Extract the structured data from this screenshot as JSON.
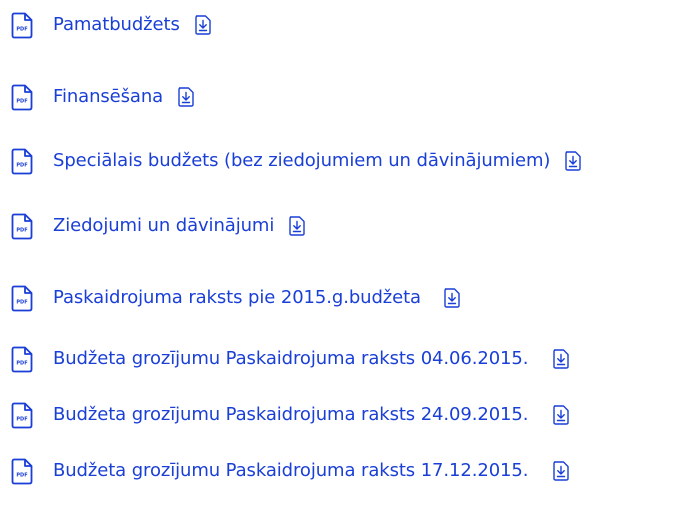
{
  "colors": {
    "link": "#1a3fd6"
  },
  "icons": {
    "file": "pdf-file-icon",
    "download": "download-icon",
    "file_badge": "PDF"
  },
  "documents": [
    {
      "label": "Pamatbudžets",
      "spacer": ""
    },
    {
      "label": "Finansēšana",
      "spacer": ""
    },
    {
      "label": "Speciālais budžets (bez ziedojumiem un dāvinājumiem)",
      "spacer": ""
    },
    {
      "label": "Ziedojumi un dāvinājumi",
      "spacer": ""
    },
    {
      "label": "Paskaidrojuma raksts pie 2015.g.budžeta",
      "spacer": ""
    },
    {
      "label": "Budžeta grozījumu Paskaidrojuma raksts 04.06.2015.",
      "spacer": ""
    },
    {
      "label": "Budžeta grozījumu Paskaidrojuma raksts 24.09.2015.",
      "spacer": ""
    },
    {
      "label": "Budžeta grozījumu Paskaidrojuma raksts 17.12.2015.",
      "spacer": ""
    }
  ]
}
